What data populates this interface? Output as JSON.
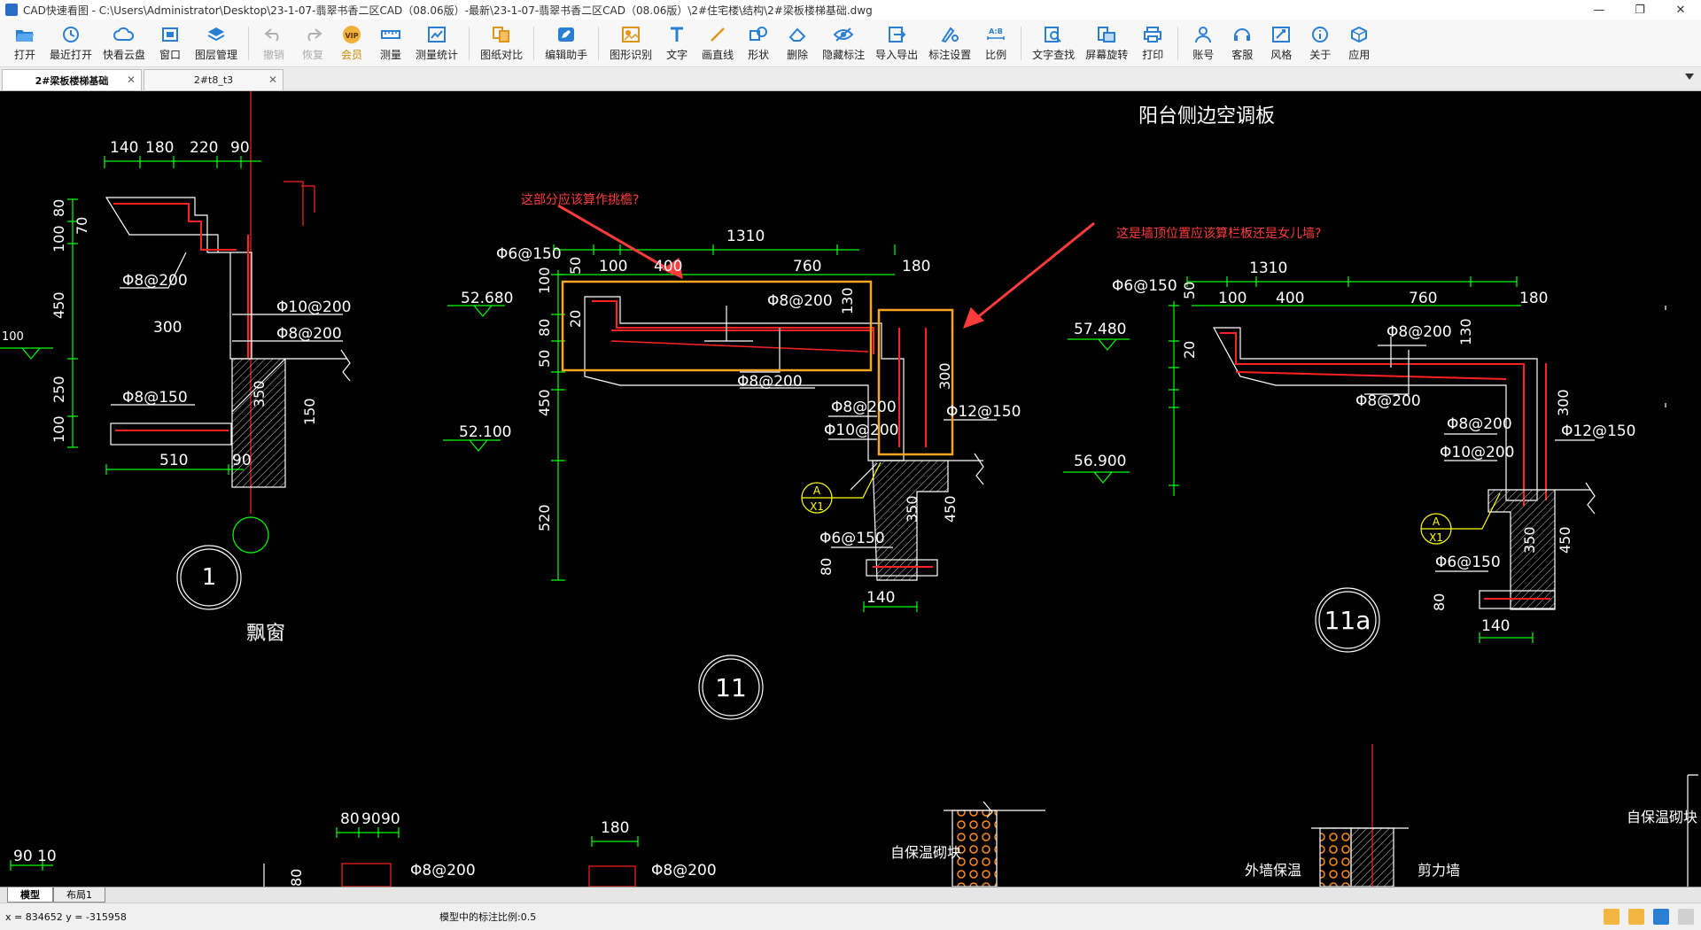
{
  "window": {
    "title": "CAD快速看图 - C:\\Users\\Administrator\\Desktop\\23-1-07-翡翠书香二区CAD（08.06版）-最新\\23-1-07-翡翠书香二区CAD（08.06版）\\2#住宅楼\\结构\\2#梁板楼梯基础.dwg",
    "min": "—",
    "max": "❐",
    "close": "✕"
  },
  "toolbar": {
    "items": [
      {
        "label": "打开",
        "icon": "folder-open-icon"
      },
      {
        "label": "最近打开",
        "icon": "history-icon"
      },
      {
        "label": "快看云盘",
        "icon": "cloud-icon"
      },
      {
        "label": "窗口",
        "icon": "window-icon"
      },
      {
        "label": "图层管理",
        "icon": "layers-icon"
      },
      {
        "label": "撤销",
        "icon": "undo-icon"
      },
      {
        "label": "恢复",
        "icon": "redo-icon"
      },
      {
        "label": "会员",
        "icon": "vip-icon"
      },
      {
        "label": "测量",
        "icon": "ruler-icon"
      },
      {
        "label": "测量统计",
        "icon": "measure-stats-icon"
      },
      {
        "label": "图纸对比",
        "icon": "compare-icon"
      },
      {
        "label": "编辑助手",
        "icon": "edit-assistant-icon"
      },
      {
        "label": "图形识别",
        "icon": "shape-recognize-icon"
      },
      {
        "label": "文字",
        "icon": "text-icon"
      },
      {
        "label": "画直线",
        "icon": "line-icon"
      },
      {
        "label": "形状",
        "icon": "shape-icon"
      },
      {
        "label": "删除",
        "icon": "eraser-icon"
      },
      {
        "label": "隐藏标注",
        "icon": "eye-hide-icon"
      },
      {
        "label": "导入导出",
        "icon": "import-export-icon"
      },
      {
        "label": "标注设置",
        "icon": "annotation-settings-icon"
      },
      {
        "label": "比例",
        "icon": "scale-icon"
      },
      {
        "label": "文字查找",
        "icon": "text-search-icon"
      },
      {
        "label": "屏幕旋转",
        "icon": "rotate-screen-icon"
      },
      {
        "label": "打印",
        "icon": "print-icon"
      },
      {
        "label": "账号",
        "icon": "account-icon"
      },
      {
        "label": "客服",
        "icon": "headset-icon"
      },
      {
        "label": "风格",
        "icon": "style-icon"
      },
      {
        "label": "关于",
        "icon": "info-icon"
      },
      {
        "label": "应用",
        "icon": "apps-icon"
      }
    ],
    "vip_badge": "VIP",
    "ab_text": "A:B"
  },
  "tabs": [
    {
      "label": "2#梁板楼梯基础",
      "active": true,
      "close": "✕"
    },
    {
      "label": "2#t8_t3",
      "active": false,
      "close": "✕"
    }
  ],
  "drawing": {
    "title_right": "阳台侧边空调板",
    "note1": "这部分应该算作挑檐?",
    "note2": "这是墙顶位置应该算栏板还是女儿墙?",
    "label_piaochuang": "飘窗",
    "circle_1": "1",
    "circle_11": "11",
    "circle_11a": "11a",
    "dims_left_top": [
      "140",
      "180",
      "220",
      "90"
    ],
    "dims_left_vert": [
      "80",
      "100",
      "70",
      "450",
      "250",
      "100"
    ],
    "rebar_left": [
      "Φ8@200",
      "Φ10@200",
      "Φ8@200",
      "Φ8@150"
    ],
    "left_misc": [
      "300",
      "350",
      "150",
      "510",
      "90"
    ],
    "mid_dim_top": "1310",
    "mid_dims": [
      "100",
      "400",
      "760",
      "180"
    ],
    "mid_dim_150": "Φ6@150",
    "mid_dims_small": [
      "50",
      "20",
      "130"
    ],
    "mid_vert": [
      "100",
      "80",
      "50",
      "450",
      "520"
    ],
    "mid_levels": [
      "52.680",
      "52.100"
    ],
    "mid_rebar": [
      "Φ8@200",
      "Φ8@200",
      "Φ8@200",
      "Φ10@200",
      "Φ12@150",
      "Φ6@150"
    ],
    "mid_misc": [
      "300",
      "350",
      "450",
      "80",
      "140"
    ],
    "axis_marker": [
      "A",
      "X1"
    ],
    "right_dim_top": "1310",
    "right_dims": [
      "100",
      "400",
      "760",
      "180"
    ],
    "right_levels": [
      "57.480",
      "56.900"
    ],
    "right_rebar": [
      "Φ6@150",
      "Φ8@200",
      "Φ8@200",
      "Φ8@200",
      "Φ12@150",
      "Φ10@200",
      "Φ6@150"
    ],
    "right_misc": [
      "50",
      "20",
      "130",
      "300",
      "350",
      "450",
      "80",
      "140"
    ],
    "left_edge_level": "100",
    "bottom_dims": [
      "80",
      "90",
      "90",
      "180",
      "90",
      "10",
      "80"
    ],
    "bottom_rebar": [
      "Φ8@200",
      "Φ8@200"
    ],
    "bottom_labels": [
      "自保温砌块",
      "外墙保温",
      "剪力墙",
      "自保温砌块"
    ]
  },
  "layout_tabs": [
    {
      "label": "模型",
      "active": true
    },
    {
      "label": "布局1",
      "active": false
    }
  ],
  "status": {
    "coords": "x = 834652  y = -315958",
    "scale_text": "模型中的标注比例:0.5"
  },
  "colors": {
    "canvas": "#000000",
    "dim_green": "#00ff00",
    "rebar_red": "#ff2020",
    "annotation_orange": "#f5a623",
    "note_red": "#ff3b3b",
    "yellow": "#ffff00",
    "white": "#ffffff"
  }
}
